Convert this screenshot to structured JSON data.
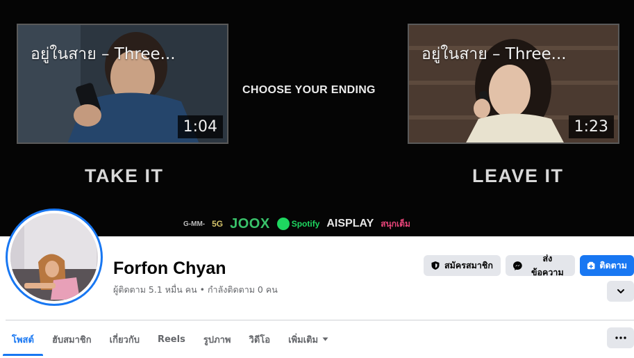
{
  "cover": {
    "left_video": {
      "title": "อยู่ในสาย – Three...",
      "duration": "1:04",
      "caption": "TAKE IT"
    },
    "right_video": {
      "title": "อยู่ในสาย – Three...",
      "duration": "1:23",
      "caption": "LEAVE IT"
    },
    "center_text": "CHOOSE YOUR ENDING",
    "sponsors": [
      "G-MM-",
      "5G",
      "JOOX",
      "Spotify",
      "AISPLAY",
      "สนุกเต็ม"
    ]
  },
  "profile": {
    "name": "Forfon Chyan",
    "stats": "ผู้ติดตาม 5.1 หมื่น คน • กำลังติดตาม 0 คน"
  },
  "actions": {
    "subscribe": "สมัครสมาชิก",
    "message": "ส่งข้อความ",
    "follow": "ติดตาม"
  },
  "tabs": [
    {
      "label": "โพสต์",
      "active": true
    },
    {
      "label": "ฮับสมาชิก",
      "active": false
    },
    {
      "label": "เกี่ยวกับ",
      "active": false
    },
    {
      "label": "Reels",
      "active": false
    },
    {
      "label": "รูปภาพ",
      "active": false
    },
    {
      "label": "วิดีโอ",
      "active": false
    },
    {
      "label": "เพิ่มเติม",
      "active": false
    }
  ],
  "colors": {
    "accent": "#1877f2",
    "button_grey": "#e4e6eb",
    "text_secondary": "#65676b"
  },
  "icons": [
    "shield-icon",
    "messenger-icon",
    "follow-plus-icon",
    "chevron-down-icon",
    "more-dots-icon"
  ]
}
